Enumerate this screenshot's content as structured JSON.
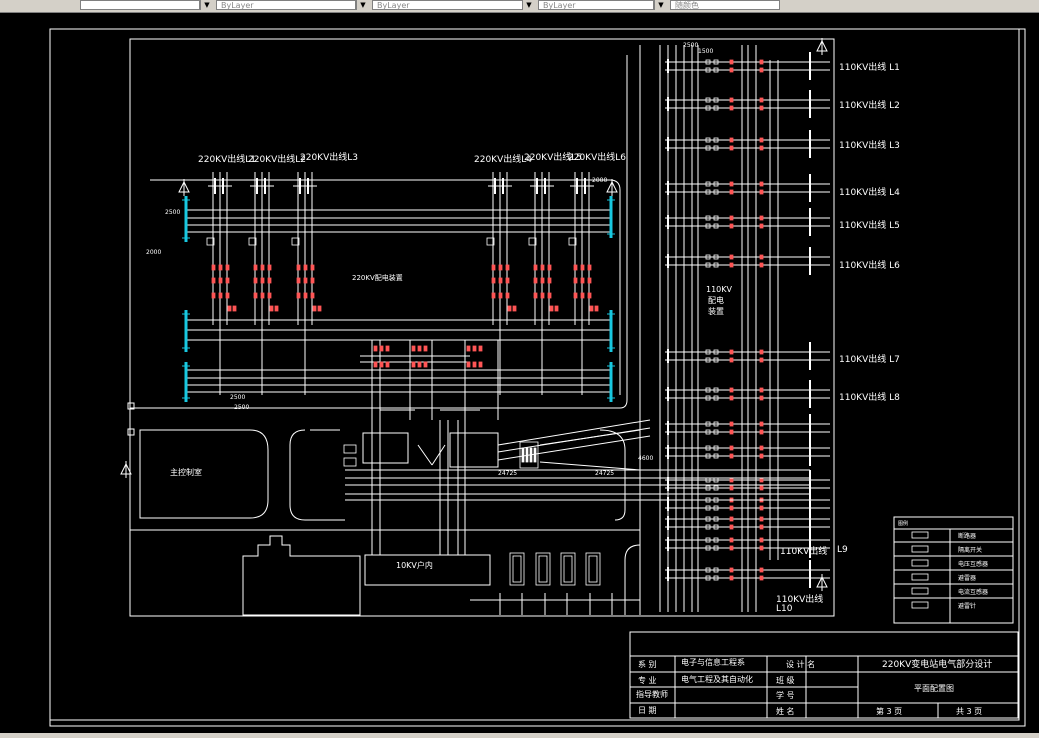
{
  "toolbar": {
    "layer_value": "",
    "color_value": "ByLayer",
    "linetype_value": "ByLayer",
    "lineweight_value": "ByLayer",
    "plotstyle_value": "随颜色"
  },
  "drawing": {
    "bay_220_left": [
      "220KV出线L1",
      "220KV出线L2",
      "220KV出线L3"
    ],
    "bay_220_right": [
      "220KV出线L4",
      "220KV出线L5",
      "220KV出线L6"
    ],
    "area_220": "220KV配电装置",
    "area_110": [
      "110KV",
      "配电",
      "装置"
    ],
    "lines_110": [
      "110KV出线  L1",
      "110KV出线  L2",
      "110KV出线  L3",
      "110KV出线  L4",
      "110KV出线  L5",
      "110KV出线  L6",
      "110KV出线  L7",
      "110KV出线  L8"
    ],
    "line_110_9": "110KV出线",
    "line_110_9_num": "L9",
    "line_110_10": "110KV出线",
    "line_110_10_num": "L10",
    "main_control": "主控制室",
    "room_10kv": "10KV户内",
    "dims": {
      "d2500_top": "2500",
      "d1500_top": "1500",
      "d2500_left": "2500",
      "d2000_left": "2000",
      "d2500_bot1": "2500",
      "d2500_bot2": "2500",
      "d24725a": "24725",
      "d24725b": "24725",
      "d4600": "4600",
      "d2000_r": "2000"
    }
  },
  "legend": {
    "title": "图例",
    "items": [
      "断路器",
      "隔离开关",
      "电压互感器",
      "避雷器",
      "电流互感器",
      "避雷针"
    ]
  },
  "title_block": {
    "dept_label": "系  别",
    "dept_value": "电子与信息工程系",
    "major_label": "专  业",
    "major_value": "电气工程及其自动化",
    "advisor_label": "指导教师",
    "date_label": "日  期",
    "design_label": "设  计  名",
    "class_label": "班  级",
    "id_label": "学  号",
    "name_label": "姓  名",
    "project_title": "220KV变电站电气部分设计",
    "drawing_name": "平面配置图",
    "page_label": "第 3 页",
    "total_label": "共 3 页"
  }
}
